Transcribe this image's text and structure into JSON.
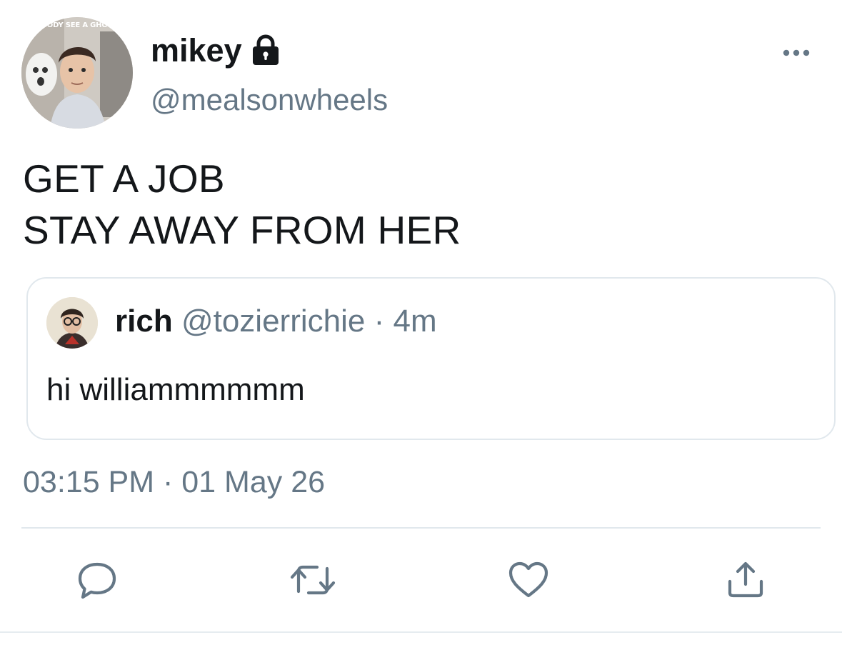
{
  "author": {
    "display_name": "mikey",
    "handle": "@mealsonwheels",
    "protected_icon": "lock-icon",
    "avatar_caption": "BODY SEE A GHOS"
  },
  "tweet": {
    "lines": [
      "GET A JOB",
      "STAY AWAY FROM HER"
    ],
    "timestamp": "03:15 PM · 01 May 26"
  },
  "quote": {
    "display_name": "rich",
    "handle": "@tozierrichie",
    "separator": "·",
    "time": "4m",
    "text": "hi williammmmmm"
  },
  "actions": {
    "more_icon": "more-horizontal-icon",
    "reply_icon": "reply-icon",
    "retweet_icon": "retweet-icon",
    "like_icon": "heart-icon",
    "share_icon": "share-icon"
  },
  "colors": {
    "primary_text": "#14171a",
    "secondary_text": "#657786",
    "border": "#e1e8ed",
    "icon": "#657786"
  }
}
